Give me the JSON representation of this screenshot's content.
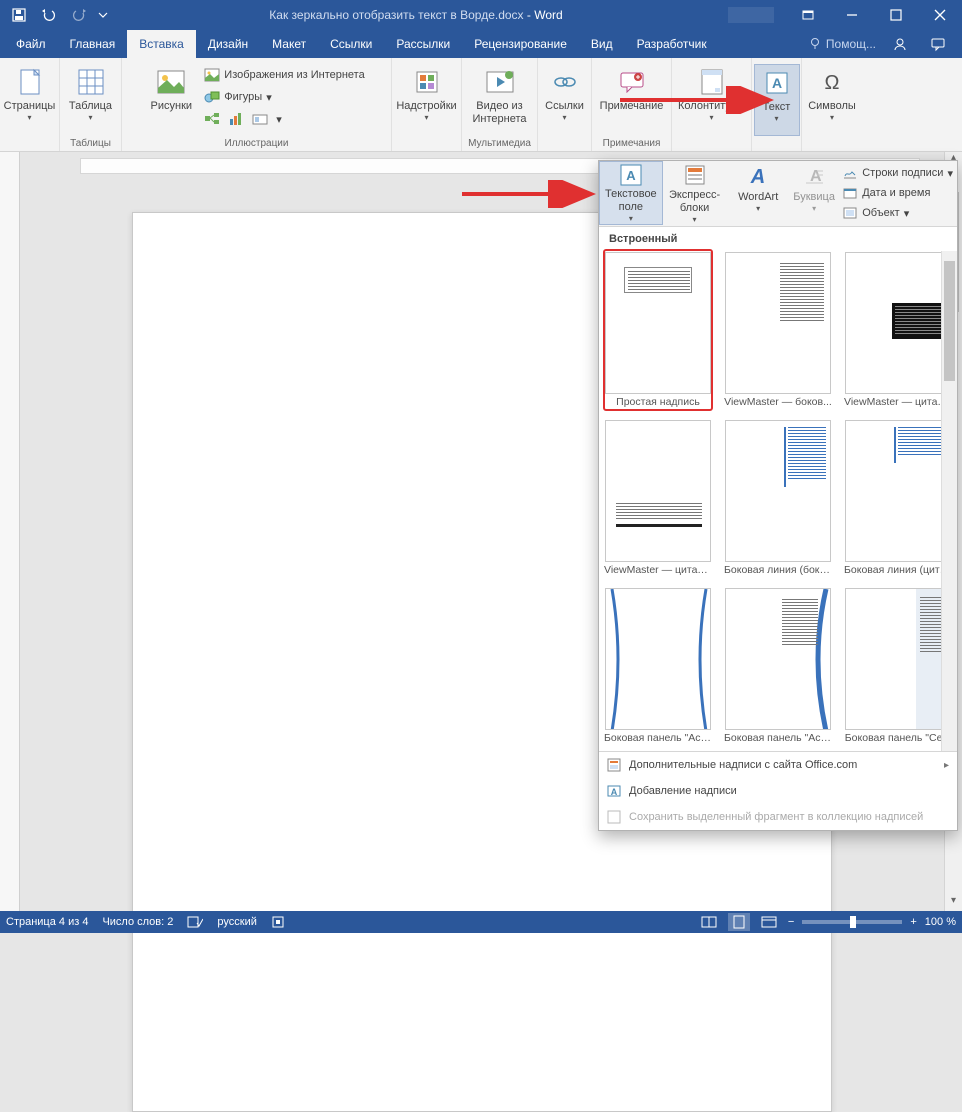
{
  "title": {
    "doc": "Как зеркально отобразить текст в Ворде.docx",
    "app": "Word"
  },
  "qat": {
    "save": "save-icon",
    "undo": "undo-icon",
    "redo": "redo-icon",
    "customize": "customize-qat"
  },
  "tabs": {
    "items": [
      {
        "label": "Файл"
      },
      {
        "label": "Главная"
      },
      {
        "label": "Вставка"
      },
      {
        "label": "Дизайн"
      },
      {
        "label": "Макет"
      },
      {
        "label": "Ссылки"
      },
      {
        "label": "Рассылки"
      },
      {
        "label": "Рецензирование"
      },
      {
        "label": "Вид"
      },
      {
        "label": "Разработчик"
      }
    ],
    "tell_me": "Помощ..."
  },
  "ribbon": {
    "groups": {
      "pages": {
        "label": "",
        "btn": "Страницы"
      },
      "tables": {
        "label": "Таблицы",
        "btn": "Таблица"
      },
      "illus": {
        "label": "Иллюстрации",
        "pictures": "Рисунки",
        "online_images": "Изображения из Интернета",
        "shapes": "Фигуры",
        "smartart": "",
        "chart": "",
        "screenshot": ""
      },
      "addins": {
        "label": "",
        "btn": "Надстройки"
      },
      "media": {
        "label": "Мультимедиа",
        "btn": "Видео из Интернета"
      },
      "links": {
        "label": "",
        "btn": "Ссылки"
      },
      "comments": {
        "label": "Примечания",
        "btn": "Примечание"
      },
      "headers": {
        "label": "",
        "btn": "Колонтитулы"
      },
      "text": {
        "label": "",
        "btn": "Текст"
      },
      "symbols": {
        "label": "",
        "btn": "Символы"
      }
    }
  },
  "text_dropdown": {
    "panel_ribbon": {
      "textbox": "Текстовое поле",
      "quickparts": "Экспресс-блоки",
      "wordart": "WordArt",
      "dropcap": "Буквица",
      "sigline": "Строки подписи",
      "datetime": "Дата и время",
      "object": "Объект"
    },
    "gallery_head": "Встроенный",
    "gallery": [
      {
        "label": "Простая надпись",
        "selected": true,
        "kind": "simple"
      },
      {
        "label": "ViewMaster — боков...",
        "kind": "side-text"
      },
      {
        "label": "ViewMaster — цитата...",
        "kind": "black-box"
      },
      {
        "label": "ViewMaster — цитата...",
        "kind": "bottom-strip"
      },
      {
        "label": "Боковая линия (боко...",
        "kind": "blue-side-right"
      },
      {
        "label": "Боковая линия (цита...",
        "kind": "blue-side-right2"
      },
      {
        "label": "Боковая панель \"Асп...",
        "kind": "blue-curve-empty"
      },
      {
        "label": "Боковая панель \"Асп...",
        "kind": "blue-curve-text"
      },
      {
        "label": "Боковая панель \"Се...",
        "kind": "grey-side-text"
      }
    ],
    "footer": {
      "more": "Дополнительные надписи с сайта Office.com",
      "draw": "Добавление надписи",
      "save": "Сохранить выделенный фрагмент в коллекцию надписей"
    }
  },
  "status": {
    "page": "Страница 4 из 4",
    "words": "Число слов: 2",
    "lang": "русский",
    "zoom": "100 %"
  }
}
